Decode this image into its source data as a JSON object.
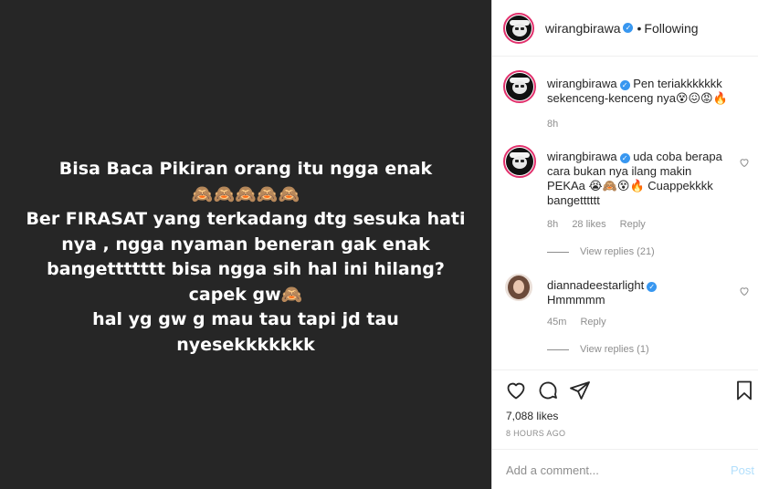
{
  "post": {
    "lines": [
      "Bisa Baca Pikiran orang itu ngga enak",
      "🙈🙈🙈🙈🙈",
      "Ber FIRASAT yang terkadang dtg sesuka hati",
      "nya , ngga nyaman beneran gak enak",
      "bangettttttt bisa ngga sih hal ini hilang?",
      "capek gw🙈",
      "hal yg gw g mau tau tapi jd tau",
      "nyesekkkkkkk"
    ]
  },
  "header": {
    "username": "wirangbirawa",
    "dot": "•",
    "follow_status": "Following"
  },
  "caption": {
    "username": "wirangbirawa",
    "text": "Pen teriakkkkkkk sekenceng-kenceng nya😵😖😡🔥",
    "time": "8h"
  },
  "comments": [
    {
      "username": "wirangbirawa",
      "text": "uda coba berapa cara bukan nya ilang makin PEKAa 😭🙈😵🔥 Cuappekkkk bangetttttt",
      "time": "8h",
      "likes": "28 likes",
      "reply": "Reply",
      "view_replies": "View replies (21)"
    },
    {
      "username": "diannadeestarlight",
      "text": "Hmmmmm",
      "time": "45m",
      "reply": "Reply",
      "view_replies": "View replies (1)"
    }
  ],
  "stats": {
    "likes": "7,088 likes",
    "posted": "8 HOURS AGO"
  },
  "composer": {
    "placeholder": "Add a comment...",
    "post_label": "Post"
  },
  "icons": {
    "verified": "verified-badge",
    "like": "heart-icon",
    "comment": "comment-icon",
    "share": "share-icon",
    "save": "bookmark-icon"
  },
  "colors": {
    "media_bg": "#262626",
    "verified": "#3897f0",
    "story_ring": "#e1306c",
    "post_disabled": "#b2dffc"
  }
}
